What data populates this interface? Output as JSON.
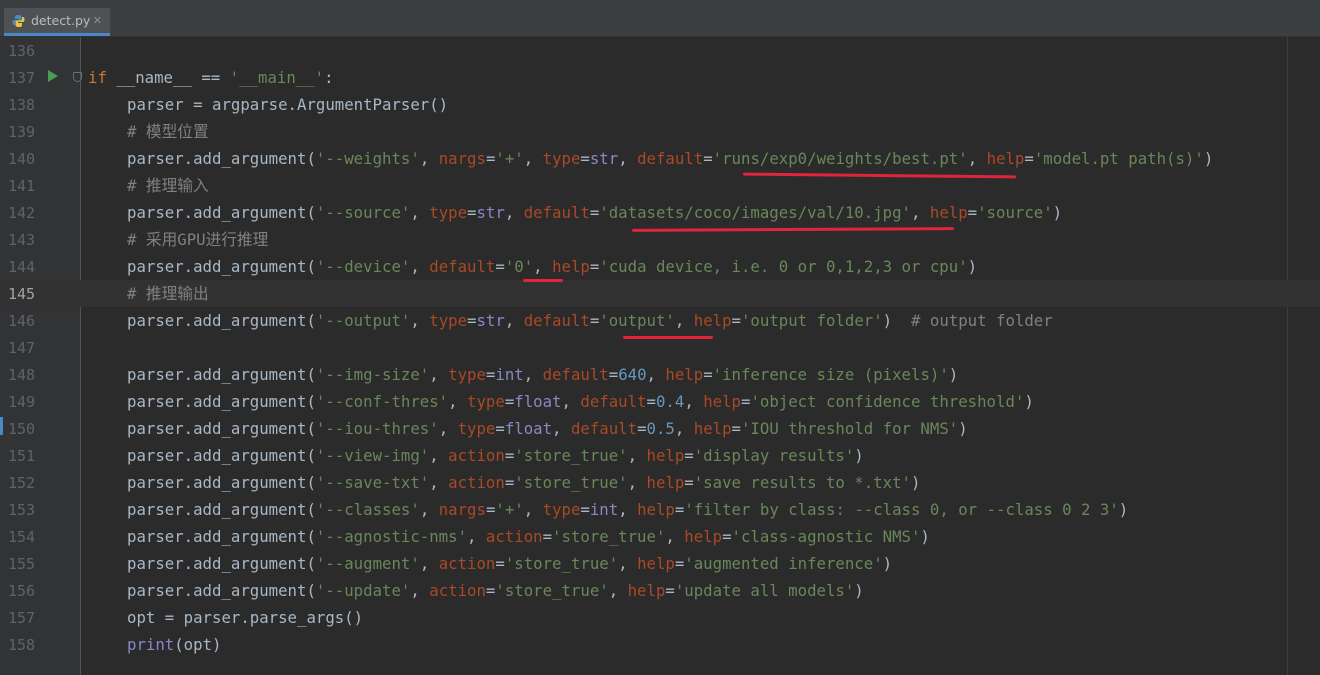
{
  "tab": {
    "filename": "detect.py",
    "close": "✕"
  },
  "current_line": "145",
  "lines": [
    {
      "n": "136"
    },
    {
      "n": "137"
    },
    {
      "n": "138"
    },
    {
      "n": "139"
    },
    {
      "n": "140"
    },
    {
      "n": "141"
    },
    {
      "n": "142"
    },
    {
      "n": "143"
    },
    {
      "n": "144"
    },
    {
      "n": "145"
    },
    {
      "n": "146"
    },
    {
      "n": "147"
    },
    {
      "n": "148"
    },
    {
      "n": "149"
    },
    {
      "n": "150"
    },
    {
      "n": "151"
    },
    {
      "n": "152"
    },
    {
      "n": "153"
    },
    {
      "n": "154"
    },
    {
      "n": "155"
    },
    {
      "n": "156"
    },
    {
      "n": "157"
    },
    {
      "n": "158"
    }
  ],
  "code": {
    "l137": [
      "if",
      " __name__ == ",
      "'__main__'",
      ":"
    ],
    "l138": "parser = argparse.ArgumentParser()",
    "l139": "# 模型位置",
    "l140": {
      "a": "parser.add_argument(",
      "s1": "'--weights'",
      "p1": "nargs",
      "s2": "'+'",
      "p2": "type",
      "b1": "str",
      "p3": "default",
      "s3": "'runs/exp0/weights/best.pt'",
      "p4": "help",
      "s4": "'model.pt path(s)'"
    },
    "l141": "# 推理输入",
    "l142": {
      "a": "parser.add_argument(",
      "s1": "'--source'",
      "p1": "type",
      "b1": "str",
      "p2": "default",
      "s2": "'datasets/coco/images/val/10.jpg'",
      "p3": "help",
      "s3": "'source'"
    },
    "l143": "# 采用GPU进行推理",
    "l144": {
      "a": "parser.add_argument(",
      "s1": "'--device'",
      "p1": "default",
      "s2": "'0'",
      "p2": "help",
      "s3": "'cuda device, i.e. 0 or 0,1,2,3 or cpu'"
    },
    "l145": "# 推理输出",
    "l146": {
      "a": "parser.add_argument(",
      "s1": "'--output'",
      "p1": "type",
      "b1": "str",
      "p2": "default",
      "s2": "'output'",
      "p3": "help",
      "s3": "'output folder'",
      "c": "# output folder"
    },
    "l148": {
      "a": "parser.add_argument(",
      "s1": "'--img-size'",
      "p1": "type",
      "b1": "int",
      "p2": "default",
      "n1": "640",
      "p3": "help",
      "s2": "'inference size (pixels)'"
    },
    "l149": {
      "a": "parser.add_argument(",
      "s1": "'--conf-thres'",
      "p1": "type",
      "b1": "float",
      "p2": "default",
      "n1": "0.4",
      "p3": "help",
      "s2": "'object confidence threshold'"
    },
    "l150": {
      "a": "parser.add_argument(",
      "s1": "'--iou-thres'",
      "p1": "type",
      "b1": "float",
      "p2": "default",
      "n1": "0.5",
      "p3": "help",
      "s2": "'IOU threshold for NMS'"
    },
    "l151": {
      "a": "parser.add_argument(",
      "s1": "'--view-img'",
      "p1": "action",
      "s2": "'store_true'",
      "p2": "help",
      "s3": "'display results'"
    },
    "l152": {
      "a": "parser.add_argument(",
      "s1": "'--save-txt'",
      "p1": "action",
      "s2": "'store_true'",
      "p2": "help",
      "s3": "'save results to *.txt'"
    },
    "l153": {
      "a": "parser.add_argument(",
      "s1": "'--classes'",
      "p1": "nargs",
      "s2": "'+'",
      "p2": "type",
      "b1": "int",
      "p3": "help",
      "s3": "'filter by class: --class 0, or --class 0 2 3'"
    },
    "l154": {
      "a": "parser.add_argument(",
      "s1": "'--agnostic-nms'",
      "p1": "action",
      "s2": "'store_true'",
      "p2": "help",
      "s3": "'class-agnostic NMS'"
    },
    "l155": {
      "a": "parser.add_argument(",
      "s1": "'--augment'",
      "p1": "action",
      "s2": "'store_true'",
      "p2": "help",
      "s3": "'augmented inference'"
    },
    "l156": {
      "a": "parser.add_argument(",
      "s1": "'--update'",
      "p1": "action",
      "s2": "'store_true'",
      "p2": "help",
      "s3": "'update all models'"
    },
    "l157": "opt = parser.parse_args()",
    "l158": {
      "b": "print",
      "r": "(opt)"
    }
  },
  "colors": {
    "underline": "#e0243c",
    "keyword": "#cc7832",
    "string": "#6a8759",
    "param": "#aa4926",
    "builtin": "#8888c6",
    "number": "#6897bb",
    "comment": "#808080"
  }
}
